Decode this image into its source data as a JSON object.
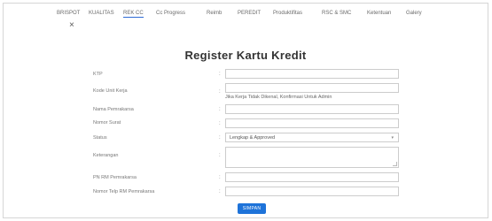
{
  "nav": {
    "items": [
      "BRISPOT",
      "KUALITAS",
      "REK CC",
      "Cc Progress",
      "Reimb",
      "PEREDIT",
      "Produktifitas",
      "RSC & SMC",
      "Ketentuan",
      "Galery"
    ],
    "active_index": 2
  },
  "close_symbol": "×",
  "title": "Register Kartu Kredit",
  "form": {
    "fields": [
      {
        "label": "KTP",
        "value": ""
      },
      {
        "label": "Kode Unit Kerja",
        "value": ""
      },
      {
        "label": "Nama Pemrakarsa",
        "value": ""
      },
      {
        "label": "Nomor Surat",
        "value": ""
      },
      {
        "label": "Status",
        "value": "Lengkap & Approved"
      },
      {
        "label": "Keterangan",
        "value": ""
      },
      {
        "label": "PN RM Pemrakarsa",
        "value": ""
      },
      {
        "label": "Nomor Telp RM Pemrakarsa",
        "value": ""
      }
    ],
    "unit_note": "Jika Kerja Tidak Dikenal, Konfirmasi Untuk Admin"
  },
  "submit_label": "SIMPAN"
}
